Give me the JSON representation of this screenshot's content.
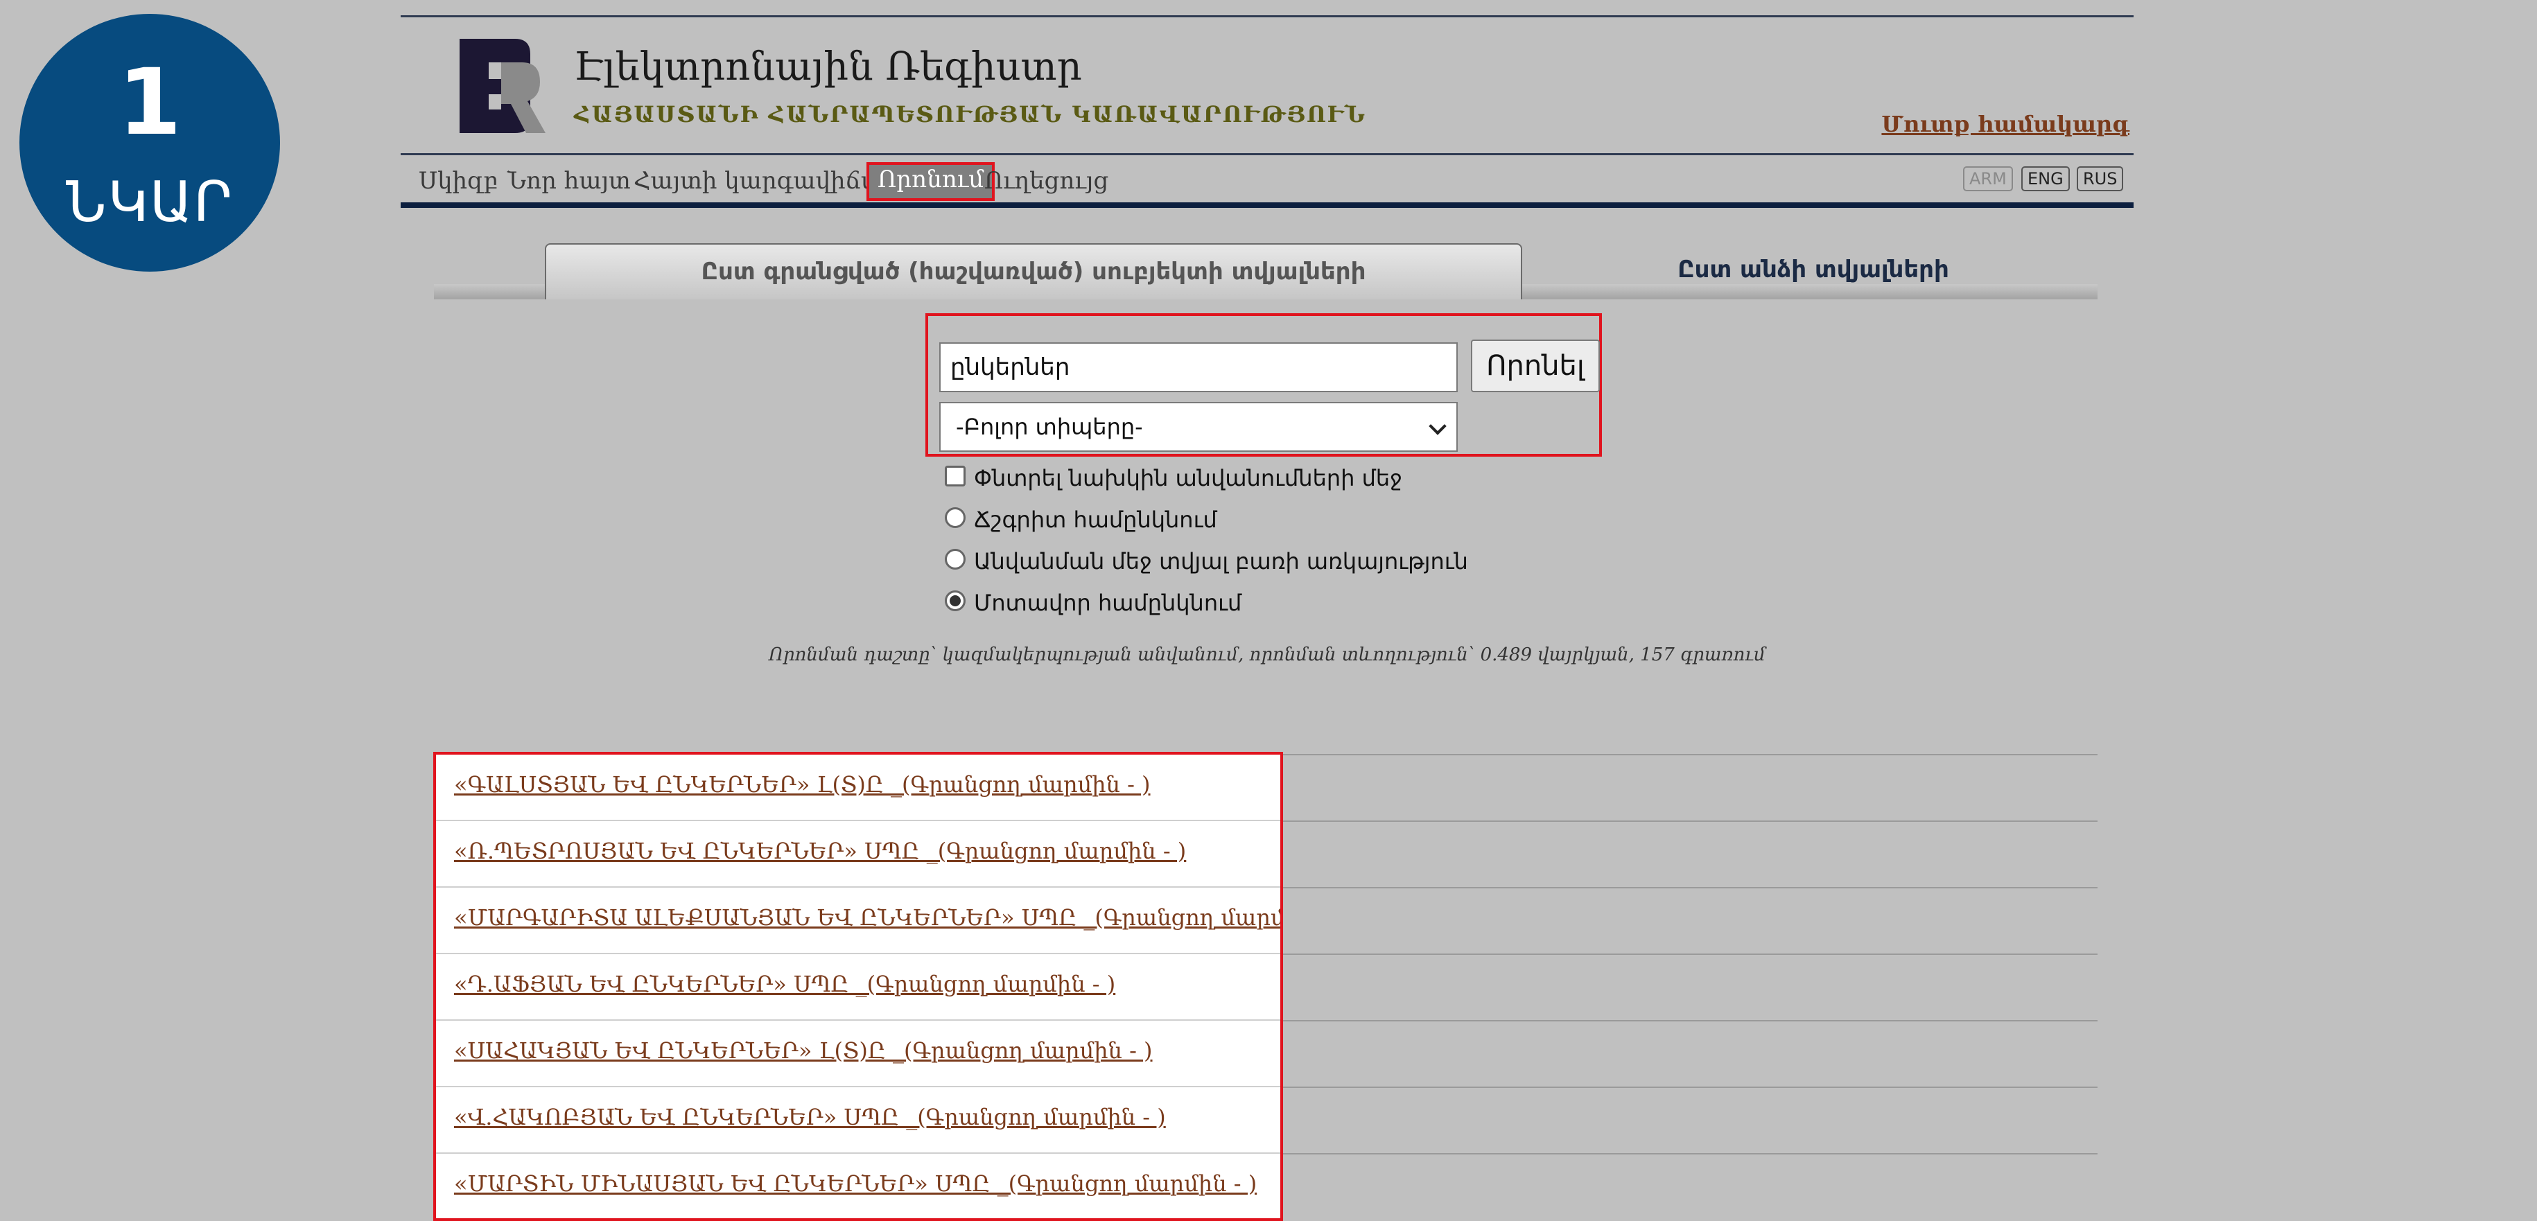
{
  "badge": {
    "number": "1",
    "word": "ՆԿԱՐ"
  },
  "header": {
    "title": "Էլեկտրոնային Ռեգիստր",
    "subtitle": "ՀԱՅԱՍՏԱՆԻ ՀԱՆՐԱՊԵՏՈՒԹՅԱՆ ԿԱՌԱՎԱՐՈՒԹՅՈՒՆ",
    "login": "Մուտք համակարգ"
  },
  "nav": {
    "items": [
      "Սկիզբ",
      "Նոր հայտ",
      "Հայտի կարգավիճակ",
      "Որոնում",
      "Ուղեցույց"
    ],
    "active_index": 3,
    "languages": [
      "ARM",
      "ENG",
      "RUS"
    ],
    "current_language": "ARM"
  },
  "tabs": {
    "by_registered": "Ըստ գրանցված (հաշվառված) սուբյեկտի տվյալների",
    "by_person": "Ըստ անձի տվյալների"
  },
  "search": {
    "query": "ընկերներ",
    "button": "Որոնել",
    "type_selected": "-Բոլոր տիպերը-"
  },
  "options": {
    "prev_names": "Փնտրել նախկին անվանումների մեջ",
    "exact": "Ճշգրիտ համընկնում",
    "contains_word": "Անվանման մեջ տվյալ բառի առկայություն",
    "approximate": "Մոտավոր համընկնում",
    "prev_names_checked": false,
    "selected_mode": "approximate"
  },
  "note": "Որոնման դաշտը՝ կազմակերպության անվանում, որոնման տևողություն՝ 0.489 վայրկյան, 157 գրառում",
  "results": [
    "«ԳԱԼՍՏՅԱՆ ԵՎ ԸՆԿԵՐՆԵՐ» Լ(Տ)Ը _(Գրանցող մարմին - )",
    "«Ռ.ՊԵՏՐՈՍՅԱՆ ԵՎ ԸՆԿԵՐՆԵՐ» ՍՊԸ _(Գրանցող մարմին - )",
    "«ՄԱՐԳԱՐԻՏԱ ԱԼԵՔՍԱՆՅԱՆ ԵՎ ԸՆԿԵՐՆԵՐ» ՍՊԸ _(Գրանցող մարմին - )",
    "«Դ.ԱՖՅԱՆ ԵՎ ԸՆԿԵՐՆԵՐ» ՍՊԸ _(Գրանցող մարմին - )",
    "«ՍԱՀԱԿՅԱՆ ԵՎ ԸՆԿԵՐՆԵՐ» Լ(Տ)Ը _(Գրանցող մարմին - )",
    "«Վ.ՀԱԿՈԲՅԱՆ ԵՎ ԸՆԿԵՐՆԵՐ» ՍՊԸ _(Գրանցող մարմին - )",
    "«ՄԱՐՏԻՆ ՄԻՆԱՍՅԱՆ ԵՎ ԸՆԿԵՐՆԵՐ» ՍՊԸ _(Գրանցող մարմին - )"
  ],
  "colors": {
    "badge": "#074b7f",
    "highlight": "#e0141e",
    "link": "#7a3b1c",
    "nav_bar": "#0c1f3f"
  }
}
